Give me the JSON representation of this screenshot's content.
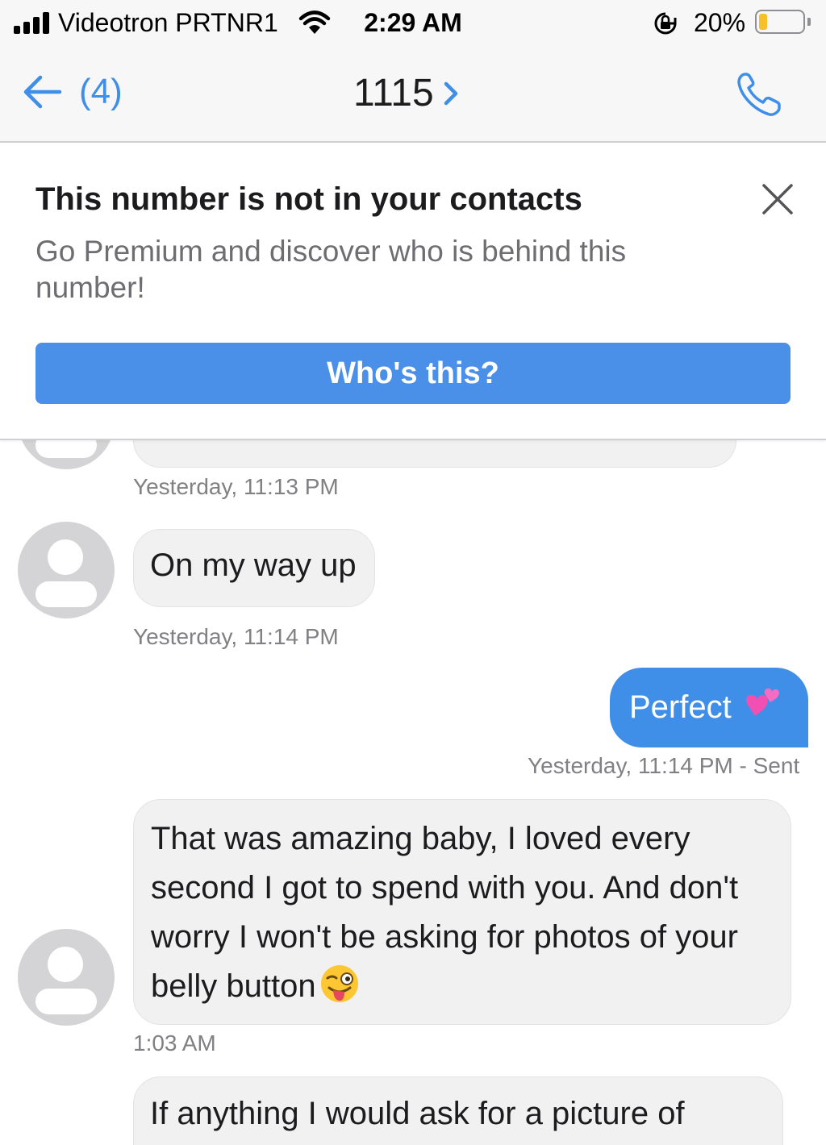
{
  "status_bar": {
    "carrier": "Videotron PRTNR1",
    "time": "2:29 AM",
    "battery_percent": "20%",
    "battery_level": 0.2,
    "signal_bars": 4
  },
  "nav": {
    "back_count": "(4)",
    "title": "1115"
  },
  "banner": {
    "title": "This number is not in your contacts",
    "subtitle": "Go Premium and discover who is behind this number!",
    "button_label": "Who's this?",
    "button_color": "#4a90e9"
  },
  "messages": [
    {
      "direction": "incoming",
      "text": "",
      "timestamp": "Yesterday, 11:13 PM",
      "partial": true
    },
    {
      "direction": "incoming",
      "text": "On my way up",
      "timestamp": "Yesterday, 11:14 PM"
    },
    {
      "direction": "outgoing",
      "text": "Perfect",
      "emoji": "two-hearts",
      "timestamp": "Yesterday, 11:14 PM - Sent"
    },
    {
      "direction": "incoming",
      "text": "That was amazing baby, I loved every second I got to spend with you. And don't worry I won't be asking for photos of your belly button",
      "emoji": "winking-face-with-tongue",
      "timestamp": "1:03 AM"
    },
    {
      "direction": "incoming",
      "text": "If anything I would ask for a picture of",
      "partial": true
    }
  ],
  "colors": {
    "accent": "#3f8fe8",
    "incoming_bubble": "#f1f1f2",
    "timestamp": "#808085"
  },
  "icons": [
    "back-arrow-icon",
    "chevron-right-icon",
    "phone-icon",
    "close-icon",
    "wifi-icon",
    "orientation-lock-icon",
    "avatar-icon",
    "two-hearts-emoji",
    "winking-tongue-emoji"
  ]
}
